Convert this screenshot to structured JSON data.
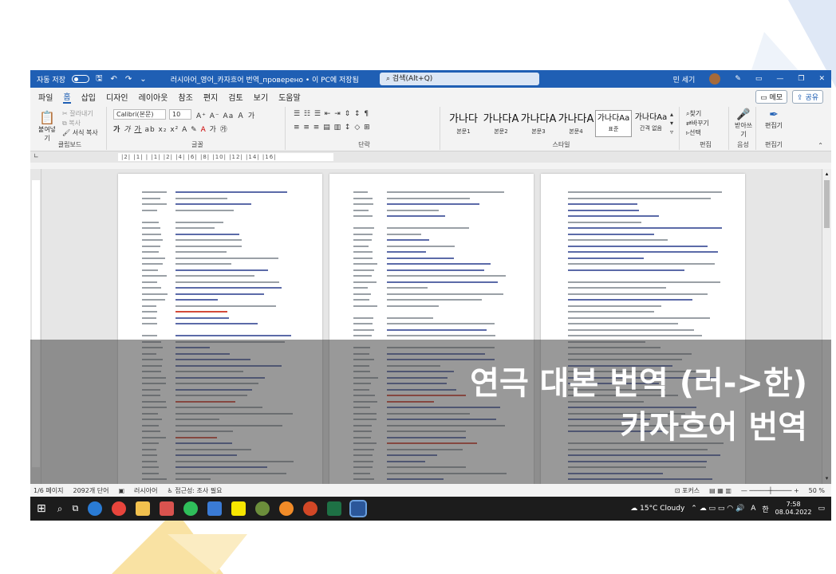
{
  "titlebar": {
    "autosave_label": "자동 저장",
    "autosave_state": "끔",
    "doc_title": "러시아어_영어_카자흐어 번역_проверено • 이 PC에 저장됨",
    "search_placeholder": "검색(Alt+Q)",
    "user_name": "민 세기"
  },
  "menu": {
    "tabs": [
      "파일",
      "홈",
      "삽입",
      "디자인",
      "레이아웃",
      "참조",
      "편지",
      "검토",
      "보기",
      "도움말"
    ],
    "memo": "메모",
    "share": "공유"
  },
  "ribbon": {
    "paste": "붙여넣기",
    "cut": "잘라내기",
    "copy": "복사",
    "format_painter": "서식 복사",
    "clipboard_label": "클립보드",
    "font_name": "Calibri(본문)",
    "font_size": "10",
    "font_label": "글꼴",
    "paragraph_label": "단락",
    "styles": [
      {
        "preview": "가나다",
        "name": "본문1"
      },
      {
        "preview": "가나다A",
        "name": "본문2"
      },
      {
        "preview": "가나다A",
        "name": "본문3"
      },
      {
        "preview": "가나다A",
        "name": "본문4"
      },
      {
        "preview": "가나다Aa",
        "name": "표준"
      },
      {
        "preview": "가나다Aa",
        "name": "간격 없음"
      }
    ],
    "style_label": "스타일",
    "find": "찾기",
    "replace": "바꾸기",
    "select": "선택",
    "edit_label": "편집",
    "dictate": "받아쓰기",
    "voice_label": "음성",
    "editor": "편집기",
    "editor_label": "편집기"
  },
  "ruler_text": "|2|  |1|  |  |1|  |2|  |4|  |6|  |8|  |10|  |12|  |14|  |16|",
  "overlay": {
    "line1": "연극 대본 번역 (러->한)",
    "line2": "카자흐어 번역"
  },
  "statusbar": {
    "page": "1/6 페이지",
    "words": "2092개 단어",
    "language": "러시아어",
    "accessibility": "접근성: 조사 필요",
    "focus": "포커스",
    "zoom": "50 %"
  },
  "taskbar": {
    "weather": "15°C Cloudy",
    "ime": "A",
    "ime2": "한",
    "time": "7:58",
    "date": "08.04.2022"
  },
  "colors": {
    "word_blue": "#1f5fb4",
    "deco_blue": "#d8e4f5",
    "deco_yellow": "#f7d98a"
  }
}
